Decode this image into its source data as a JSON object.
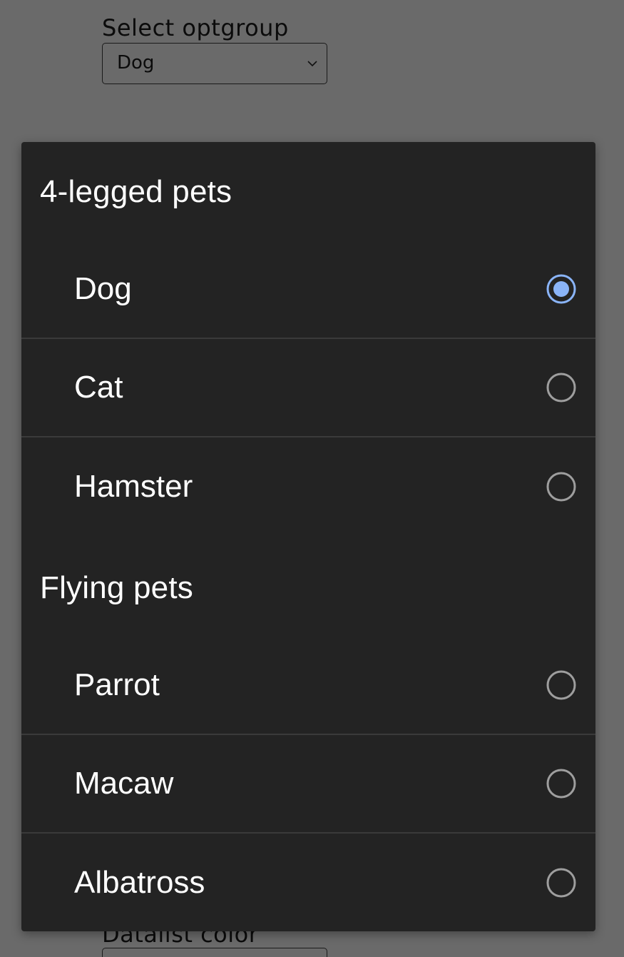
{
  "background_form": {
    "optgroup_label": "Select optgroup",
    "optgroup_value": "Dog",
    "datalist_label": "Datalist color"
  },
  "dropdown": {
    "groups": [
      {
        "label": "4-legged pets",
        "options": [
          {
            "label": "Dog",
            "selected": true
          },
          {
            "label": "Cat",
            "selected": false
          },
          {
            "label": "Hamster",
            "selected": false
          }
        ]
      },
      {
        "label": "Flying pets",
        "options": [
          {
            "label": "Parrot",
            "selected": false
          },
          {
            "label": "Macaw",
            "selected": false
          },
          {
            "label": "Albatross",
            "selected": false
          }
        ]
      }
    ]
  },
  "colors": {
    "accent": "#8ab4f8",
    "radio_off": "#9e9e9e",
    "popup_bg": "#232323",
    "scrim": "#6a6a6a"
  }
}
